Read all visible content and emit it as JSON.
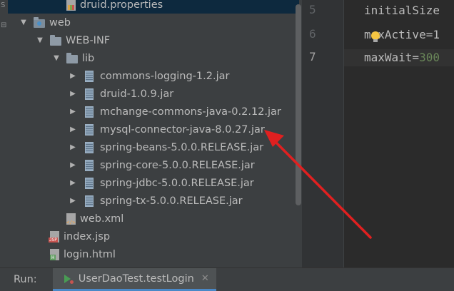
{
  "project_tree": {
    "items": [
      {
        "label": "druid.properties",
        "icon": "properties-file-icon",
        "depth": 3,
        "arrow": "",
        "selected": true
      },
      {
        "label": "web",
        "icon": "web-folder-icon",
        "depth": 1,
        "arrow": "expanded"
      },
      {
        "label": "WEB-INF",
        "icon": "folder-icon",
        "depth": 2,
        "arrow": "expanded"
      },
      {
        "label": "lib",
        "icon": "folder-icon",
        "depth": 3,
        "arrow": "expanded"
      },
      {
        "label": "commons-logging-1.2.jar",
        "icon": "jar-icon",
        "depth": 4,
        "arrow": "collapsed"
      },
      {
        "label": "druid-1.0.9.jar",
        "icon": "jar-icon",
        "depth": 4,
        "arrow": "collapsed"
      },
      {
        "label": "mchange-commons-java-0.2.12.jar",
        "icon": "jar-icon",
        "depth": 4,
        "arrow": "collapsed"
      },
      {
        "label": "mysql-connector-java-8.0.27.jar",
        "icon": "jar-icon",
        "depth": 4,
        "arrow": "collapsed"
      },
      {
        "label": "spring-beans-5.0.0.RELEASE.jar",
        "icon": "jar-icon",
        "depth": 4,
        "arrow": "collapsed"
      },
      {
        "label": "spring-core-5.0.0.RELEASE.jar",
        "icon": "jar-icon",
        "depth": 4,
        "arrow": "collapsed"
      },
      {
        "label": "spring-jdbc-5.0.0.RELEASE.jar",
        "icon": "jar-icon",
        "depth": 4,
        "arrow": "collapsed"
      },
      {
        "label": "spring-tx-5.0.0.RELEASE.jar",
        "icon": "jar-icon",
        "depth": 4,
        "arrow": "collapsed"
      },
      {
        "label": "web.xml",
        "icon": "xml-file-icon",
        "depth": 3,
        "arrow": ""
      },
      {
        "label": "index.jsp",
        "icon": "jsp-file-icon",
        "depth": 2,
        "arrow": ""
      },
      {
        "label": "login.html",
        "icon": "html-file-icon",
        "depth": 2,
        "arrow": ""
      }
    ]
  },
  "editor": {
    "line_numbers": [
      "5",
      "6",
      "7"
    ],
    "current_line": "7",
    "lines": [
      {
        "key": "initialSize",
        "value": ""
      },
      {
        "key": "maxActive=1",
        "value": ""
      },
      {
        "key": "maxWait=",
        "value": "300"
      }
    ]
  },
  "run_panel": {
    "label": "Run:",
    "tab_label": "UserDaoTest.testLogin",
    "close_glyph": "✕"
  },
  "colors": {
    "selection": "#0d293e",
    "annotation_arrow": "#e02020"
  }
}
